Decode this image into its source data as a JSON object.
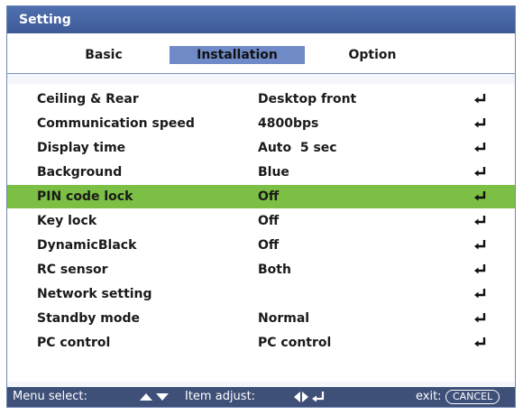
{
  "window": {
    "title": "Setting"
  },
  "tabs": [
    {
      "label": "Basic"
    },
    {
      "label": "Installation"
    },
    {
      "label": "Option"
    }
  ],
  "active_tab": "Installation",
  "settings": [
    {
      "label": "Ceiling & Rear",
      "value": "Desktop front"
    },
    {
      "label": "Communication speed",
      "value": "4800bps"
    },
    {
      "label": "Display time",
      "value": "Auto  5 sec"
    },
    {
      "label": "Background",
      "value": "Blue"
    },
    {
      "label": "PIN code lock",
      "value": "Off"
    },
    {
      "label": "Key lock",
      "value": "Off"
    },
    {
      "label": "DynamicBlack",
      "value": "Off"
    },
    {
      "label": "RC sensor",
      "value": "Both"
    },
    {
      "label": "Network setting",
      "value": ""
    },
    {
      "label": "Standby mode",
      "value": "Normal"
    },
    {
      "label": "PC control",
      "value": "PC control"
    }
  ],
  "selected_setting": "PIN code lock",
  "row_icon": "enter-icon",
  "status_bar": {
    "menu_select_label": "Menu select:",
    "item_adjust_label": "Item adjust:",
    "exit_label": "exit:",
    "cancel_label": "CANCEL"
  },
  "colors": {
    "title_bar": "#4f6fae",
    "active_tab": "#6f8ac6",
    "selected_row": "#7bbf44",
    "status_bar": "#3e4f78"
  }
}
